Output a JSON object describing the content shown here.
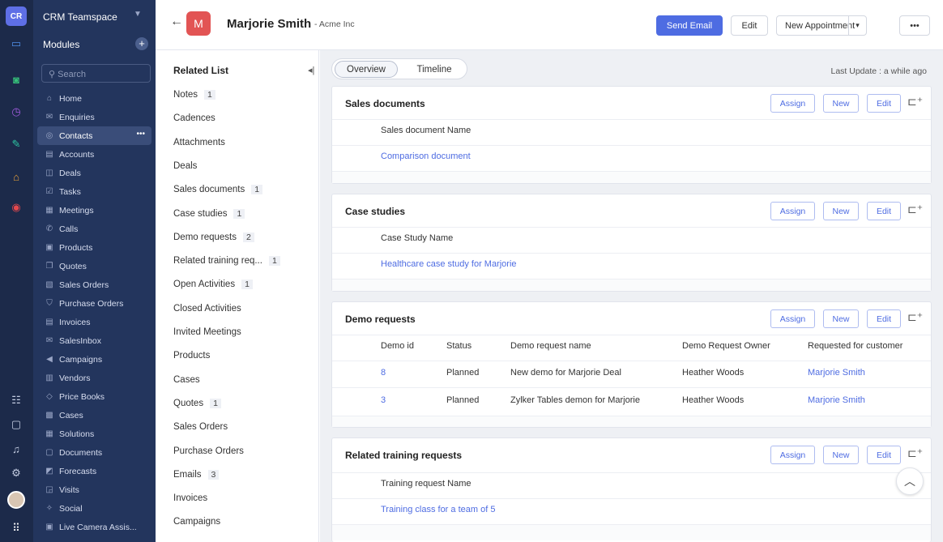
{
  "rail": {
    "logo": "CR"
  },
  "sidebar": {
    "team": "CRM Teamspace",
    "modules_label": "Modules",
    "search_placeholder": "Search",
    "items": [
      {
        "label": "Home",
        "icon": "⌂"
      },
      {
        "label": "Enquiries",
        "icon": "✉"
      },
      {
        "label": "Contacts",
        "icon": "◎",
        "active": true
      },
      {
        "label": "Accounts",
        "icon": "▤"
      },
      {
        "label": "Deals",
        "icon": "◫"
      },
      {
        "label": "Tasks",
        "icon": "☑"
      },
      {
        "label": "Meetings",
        "icon": "▦"
      },
      {
        "label": "Calls",
        "icon": "✆"
      },
      {
        "label": "Products",
        "icon": "▣"
      },
      {
        "label": "Quotes",
        "icon": "❐"
      },
      {
        "label": "Sales Orders",
        "icon": "▧"
      },
      {
        "label": "Purchase Orders",
        "icon": "⛉"
      },
      {
        "label": "Invoices",
        "icon": "▤"
      },
      {
        "label": "SalesInbox",
        "icon": "✉"
      },
      {
        "label": "Campaigns",
        "icon": "◀"
      },
      {
        "label": "Vendors",
        "icon": "▥"
      },
      {
        "label": "Price Books",
        "icon": "◇"
      },
      {
        "label": "Cases",
        "icon": "▩"
      },
      {
        "label": "Solutions",
        "icon": "▦"
      },
      {
        "label": "Documents",
        "icon": "▢"
      },
      {
        "label": "Forecasts",
        "icon": "◩"
      },
      {
        "label": "Visits",
        "icon": "◲"
      },
      {
        "label": "Social",
        "icon": "✧"
      },
      {
        "label": "Live Camera Assis...",
        "icon": "▣"
      }
    ]
  },
  "header": {
    "back": "←",
    "avatar": "M",
    "name": "Marjorie Smith",
    "org": "- Acme Inc",
    "send_email": "Send Email",
    "edit": "Edit",
    "new_appointment": "New Appointment",
    "more": "•••"
  },
  "related": {
    "title": "Related List",
    "items": [
      {
        "label": "Notes",
        "count": "1"
      },
      {
        "label": "Cadences",
        "count": ""
      },
      {
        "label": "Attachments",
        "count": ""
      },
      {
        "label": "Deals",
        "count": ""
      },
      {
        "label": "Sales documents",
        "count": "1"
      },
      {
        "label": "Case studies",
        "count": "1"
      },
      {
        "label": "Demo requests",
        "count": "2"
      },
      {
        "label": "Related training req...",
        "count": "1"
      },
      {
        "label": "Open Activities",
        "count": "1"
      },
      {
        "label": "Closed Activities",
        "count": ""
      },
      {
        "label": "Invited Meetings",
        "count": ""
      },
      {
        "label": "Products",
        "count": ""
      },
      {
        "label": "Cases",
        "count": ""
      },
      {
        "label": "Quotes",
        "count": "1"
      },
      {
        "label": "Sales Orders",
        "count": ""
      },
      {
        "label": "Purchase Orders",
        "count": ""
      },
      {
        "label": "Emails",
        "count": "3"
      },
      {
        "label": "Invoices",
        "count": ""
      },
      {
        "label": "Campaigns",
        "count": ""
      }
    ]
  },
  "main": {
    "tabs": [
      "Overview",
      "Timeline"
    ],
    "last_update": "Last Update : a while ago",
    "assign": "Assign",
    "new": "New",
    "edit": "Edit",
    "sales_documents": {
      "title": "Sales documents",
      "col": "Sales document Name",
      "value": "Comparison document"
    },
    "case_studies": {
      "title": "Case studies",
      "col": "Case Study Name",
      "value": "Healthcare case study for Marjorie"
    },
    "demo_requests": {
      "title": "Demo requests",
      "cols": [
        "Demo id",
        "Status",
        "Demo request name",
        "Demo Request Owner",
        "Requested for customer"
      ],
      "rows": [
        [
          "8",
          "Planned",
          "New demo for Marjorie Deal",
          "Heather Woods",
          "Marjorie Smith"
        ],
        [
          "3",
          "Planned",
          "Zylker Tables demon for Marjorie",
          "Heather Woods",
          "Marjorie Smith"
        ]
      ]
    },
    "training": {
      "title": "Related training requests",
      "col": "Training request Name",
      "value": "Training class for a team of 5"
    }
  }
}
